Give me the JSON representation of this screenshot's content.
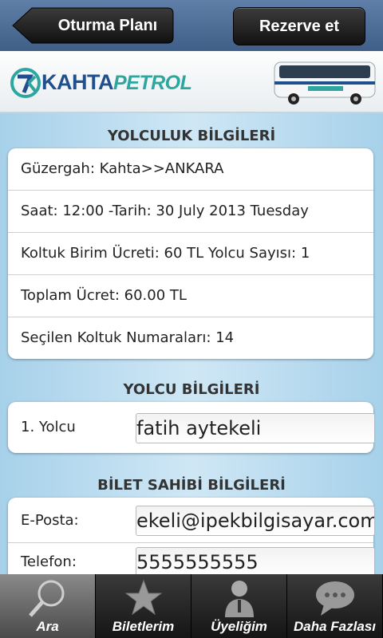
{
  "header": {
    "back_label": "Oturma Planı",
    "reserve_label": "Rezerve et"
  },
  "brand": {
    "logo_left": "KAHTA",
    "logo_right": "PETROL",
    "colors": {
      "navy": "#1f4f8c",
      "teal": "#2ea6a0"
    }
  },
  "trip_info": {
    "title": "YOLCULUK BİLGİLERİ",
    "rows": [
      "Güzergah: Kahta>>ANKARA",
      "Saat: 12:00 -Tarih: 30 July 2013 Tuesday",
      "Koltuk Birim Ücreti: 60 TL  Yolcu Sayısı: 1",
      "Toplam Ücret: 60.00 TL",
      "Seçilen Koltuk Numaraları: 14"
    ]
  },
  "passenger_info": {
    "title": "YOLCU BİLGİLERİ",
    "label": "1. Yolcu",
    "value": "fatih aytekeli"
  },
  "ticket_owner": {
    "title": "BİLET SAHİBİ BİLGİLERİ",
    "email_label": "E-Posta:",
    "email_value": "ekeli@ipekbilgisayar.com",
    "phone_label": "Telefon:",
    "phone_value": "5555555555"
  },
  "tabs": [
    {
      "label": "Ara",
      "icon": "search-icon",
      "active": true
    },
    {
      "label": "Biletlerim",
      "icon": "star-icon",
      "active": false
    },
    {
      "label": "Üyeliğim",
      "icon": "user-icon",
      "active": false
    },
    {
      "label": "Daha Fazlası",
      "icon": "chat-icon",
      "active": false
    }
  ]
}
